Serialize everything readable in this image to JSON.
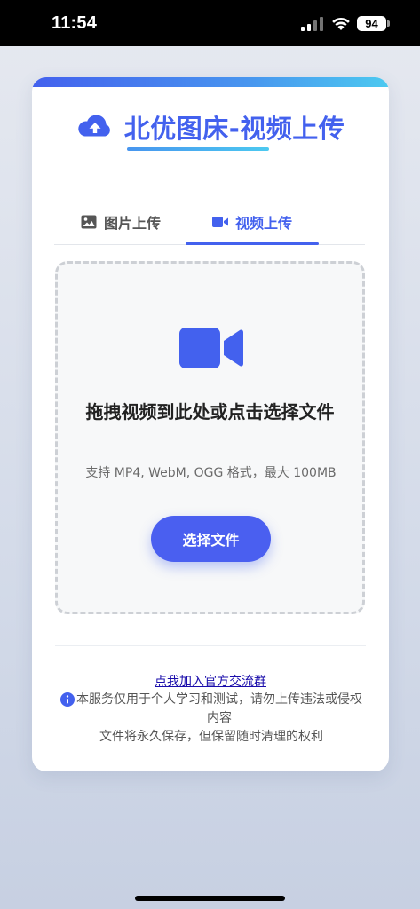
{
  "status_bar": {
    "time": "11:54",
    "battery": "94",
    "icons": [
      "signal-icon",
      "wifi-icon",
      "battery-icon"
    ]
  },
  "header": {
    "title": "北优图床-视频上传",
    "icon": "cloud-upload-icon"
  },
  "tabs": [
    {
      "label": "图片上传",
      "icon": "image-icon",
      "active": false
    },
    {
      "label": "视频上传",
      "icon": "video-camera-icon",
      "active": true
    }
  ],
  "dropzone": {
    "icon": "video-camera-icon",
    "title": "拖拽视频到此处或点击选择文件",
    "hint": "支持 MP4, WebM, OGG 格式，最大 100MB",
    "button_label": "选择文件"
  },
  "footer": {
    "group_link": "点我加入官方交流群",
    "notice_line1": "本服务仅用于个人学习和测试，请勿上传违法或侵权内容",
    "notice_line2": "文件将永久保存，但保留随时清理的权利"
  },
  "colors": {
    "accent": "#4361ee",
    "button": "#4a5ff0",
    "link": "#1a0dab"
  }
}
